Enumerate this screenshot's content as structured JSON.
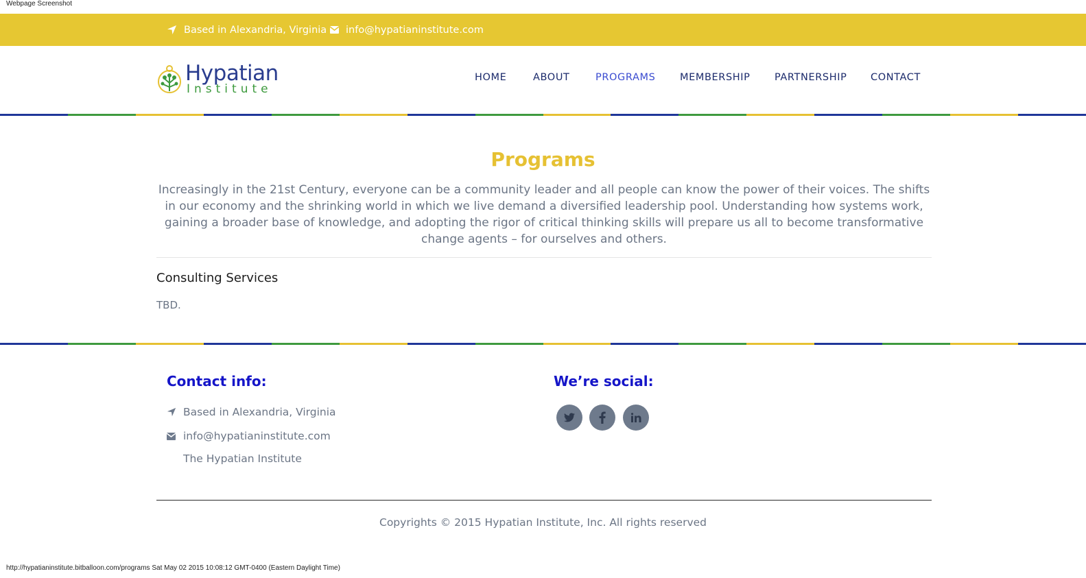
{
  "screenshot_label": "Webpage Screenshot",
  "topbar": {
    "location_text": "Based in Alexandria, Virginia",
    "email_text": "info@hypatianinstitute.com"
  },
  "logo": {
    "line1": "Hypatian",
    "line2": "Institute"
  },
  "nav": {
    "items": [
      {
        "label": "HOME"
      },
      {
        "label": "ABOUT"
      },
      {
        "label": "PROGRAMS",
        "active": true
      },
      {
        "label": "MEMBERSHIP"
      },
      {
        "label": "PARTNERSHIP"
      },
      {
        "label": "CONTACT"
      }
    ]
  },
  "colors": {
    "yellow": "#e6c732",
    "blue": "#1f3699",
    "green": "#3e9a3e",
    "heading_blue": "#1515c8"
  },
  "main": {
    "title": "Programs",
    "intro": "Increasingly in the 21st Century, everyone can be a community leader and all people can know the power of their voices. The shifts in our economy and the shrinking world in which we live demand a diversified leadership pool. Understanding how systems work, gaining a broader base of knowledge, and adopting the rigor of critical thinking skills will prepare us all to become transformative change agents – for ourselves and others.",
    "section_title": "Consulting Services",
    "section_body": "TBD."
  },
  "footer": {
    "contact_heading": "Contact info:",
    "location": "Based in Alexandria, Virginia",
    "email": "info@hypatianinstitute.com",
    "org_name": "The Hypatian Institute",
    "social_heading": "We’re social:",
    "social": [
      "twitter-icon",
      "facebook-icon",
      "linkedin-icon"
    ],
    "copyright": "Copyrights © 2015 Hypatian Institute, Inc. All rights reserved"
  },
  "status_line": "http://hypatianinstitute.bitballoon.com/programs Sat May 02 2015 10:08:12 GMT-0400 (Eastern Daylight Time)"
}
